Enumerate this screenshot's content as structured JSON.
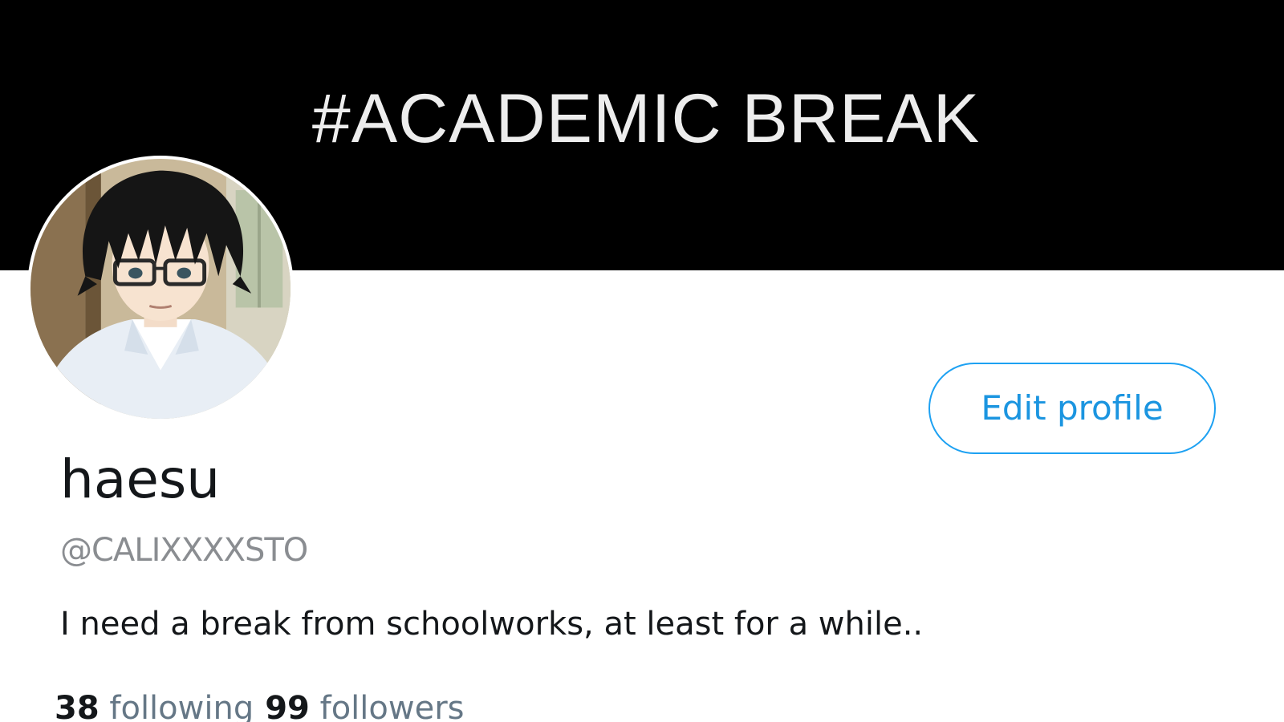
{
  "banner": {
    "text": "#ACADEMIC BREAK",
    "background_color": "#000000"
  },
  "avatar": {
    "alt": "anime character with black hair and glasses"
  },
  "profile": {
    "display_name": "haesu",
    "handle": "@CALIXXXXSTO",
    "bio": "I need a break from schoolworks, at least for a while.."
  },
  "actions": {
    "edit_profile_label": "Edit profile"
  },
  "stats": {
    "following_count": "38",
    "following_label": "following",
    "followers_count": "99",
    "followers_label": "followers"
  },
  "colors": {
    "accent": "#1da1f2",
    "text_primary": "#14171a",
    "text_secondary": "#657786"
  }
}
